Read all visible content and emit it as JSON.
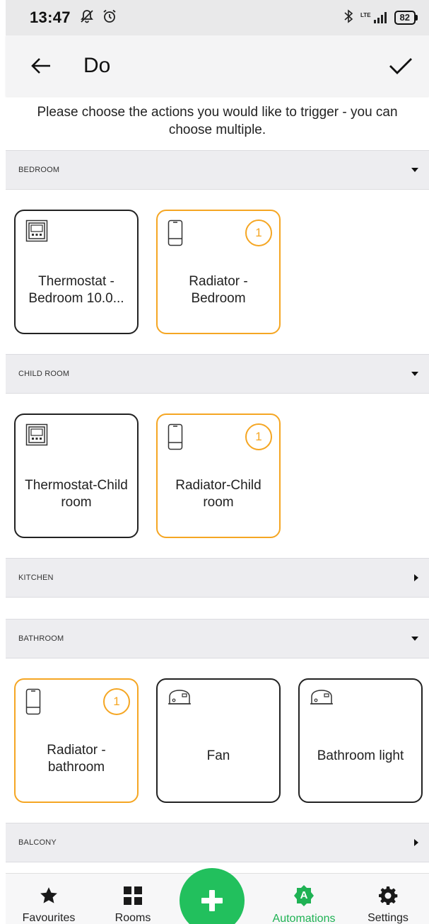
{
  "status_bar": {
    "time": "13:47",
    "network": "LTE",
    "battery": "82"
  },
  "app_bar": {
    "title": "Do"
  },
  "instruction": "Please choose the actions you would like to trigger - you can choose multiple.",
  "sections": {
    "bedroom": {
      "label": "BEDROOM",
      "expanded": true,
      "devices": [
        {
          "label": "Thermostat - Bedroom 10.0...",
          "icon": "thermostat-icon",
          "selected": false
        },
        {
          "label": "Radiator - Bedroom",
          "icon": "radiator-icon",
          "selected": true,
          "count": "1"
        }
      ]
    },
    "child_room": {
      "label": "CHILD ROOM",
      "expanded": true,
      "devices": [
        {
          "label": "Thermostat-Child room",
          "icon": "thermostat-icon",
          "selected": false
        },
        {
          "label": "Radiator-Child room",
          "icon": "radiator-icon",
          "selected": true,
          "count": "1"
        }
      ]
    },
    "kitchen": {
      "label": "KITCHEN",
      "expanded": false
    },
    "bathroom": {
      "label": "BATHROOM",
      "expanded": true,
      "devices": [
        {
          "label": "Radiator - bathroom",
          "icon": "radiator-icon",
          "selected": true,
          "count": "1"
        },
        {
          "label": "Fan",
          "icon": "switch-module-icon",
          "selected": false
        },
        {
          "label": "Bathroom light",
          "icon": "switch-module-icon",
          "selected": false
        }
      ]
    },
    "balcony": {
      "label": "BALCONY",
      "expanded": false
    }
  },
  "bottom_nav": {
    "favourites": "Favourites",
    "rooms": "Rooms",
    "automations": "Automations",
    "automations_icon_letter": "A",
    "settings": "Settings",
    "active": "automations"
  },
  "colors": {
    "selected_border": "#f5a623",
    "unselected_border": "#222222",
    "accent_green": "#22c05d",
    "section_bg": "#ededf0"
  }
}
